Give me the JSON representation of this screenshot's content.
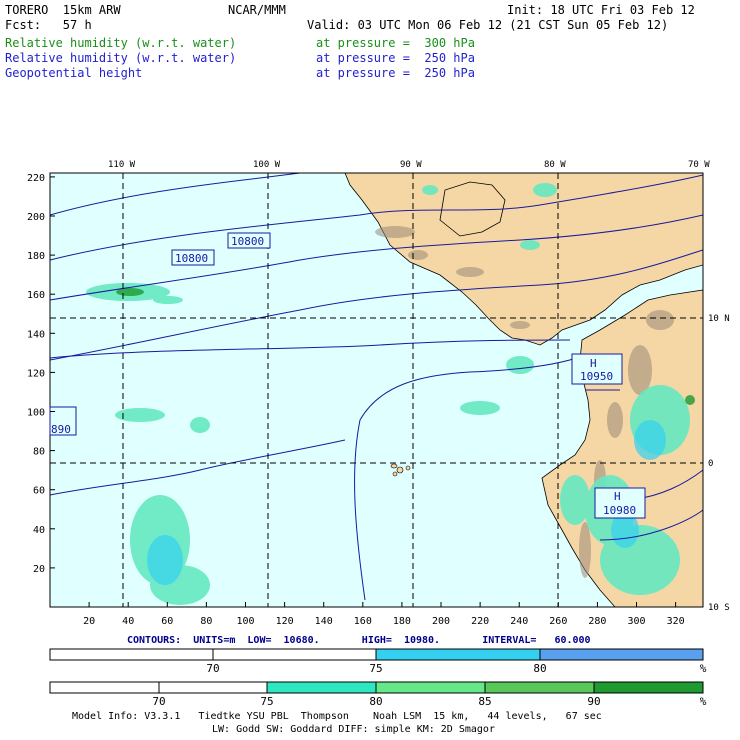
{
  "header": {
    "model": "TORERO  15km ARW",
    "org": "NCAR/MMM",
    "init": "Init: 18 UTC Fri 03 Feb 12",
    "fcst": "Fcst:   57 h",
    "valid": "Valid: 03 UTC Mon 06 Feb 12 (21 CST Sun 05 Feb 12)",
    "fields": [
      {
        "name": "Relative humidity (w.r.t. water)",
        "level": "at pressure =  300 hPa",
        "color": "#1a8f1a"
      },
      {
        "name": "Relative humidity (w.r.t. water)",
        "level": "at pressure =  250 hPa",
        "color": "#1f1fd0"
      },
      {
        "name": "Geopotential height",
        "level": "at pressure =  250 hPa",
        "color": "#1f1fd0"
      }
    ]
  },
  "map": {
    "lon_labels": [
      "110 W",
      "100 W",
      "90 W",
      "80 W",
      "70 W"
    ],
    "lat_labels": [
      "10 N",
      "0",
      "10 S"
    ],
    "y_ticks": [
      "220",
      "200",
      "180",
      "160",
      "140",
      "120",
      "100",
      "80",
      "60",
      "40",
      "20"
    ],
    "x_ticks": [
      "20",
      "40",
      "60",
      "80",
      "100",
      "120",
      "140",
      "160",
      "180",
      "200",
      "220",
      "240",
      "260",
      "280",
      "300",
      "320"
    ],
    "contour_labels": [
      "10800",
      "10800",
      "10950",
      "10980",
      "890"
    ],
    "high_markers": [
      "H",
      "H"
    ],
    "colors": {
      "ocean": "#e0ffff",
      "land": "#f5d7a6",
      "contour": "#1a1a9e",
      "terrain_dark": "#8a7a6a"
    }
  },
  "contours_info": "CONTOURS:  UNITS=m  LOW=  10680.       HIGH=  10980.       INTERVAL=   60.000",
  "colorbar1": {
    "labels": [
      "70",
      "75",
      "80",
      "%"
    ],
    "colors": [
      "#ffffff",
      "#ffffff",
      "#35d0f0",
      "#5aa0f0"
    ]
  },
  "colorbar2": {
    "labels": [
      "70",
      "75",
      "80",
      "85",
      "90",
      "%"
    ],
    "colors": [
      "#ffffff",
      "#ffffff",
      "#2ee6c0",
      "#66e88a",
      "#58c85a",
      "#1e9a30"
    ]
  },
  "footer": {
    "line1": "Model Info: V3.3.1   Tiedtke YSU PBL  Thompson    Noah LSM  15 km,   44 levels,   67 sec",
    "line2": "LW: Godd SW: Goddard DIFF: simple KM: 2D Smagor"
  }
}
